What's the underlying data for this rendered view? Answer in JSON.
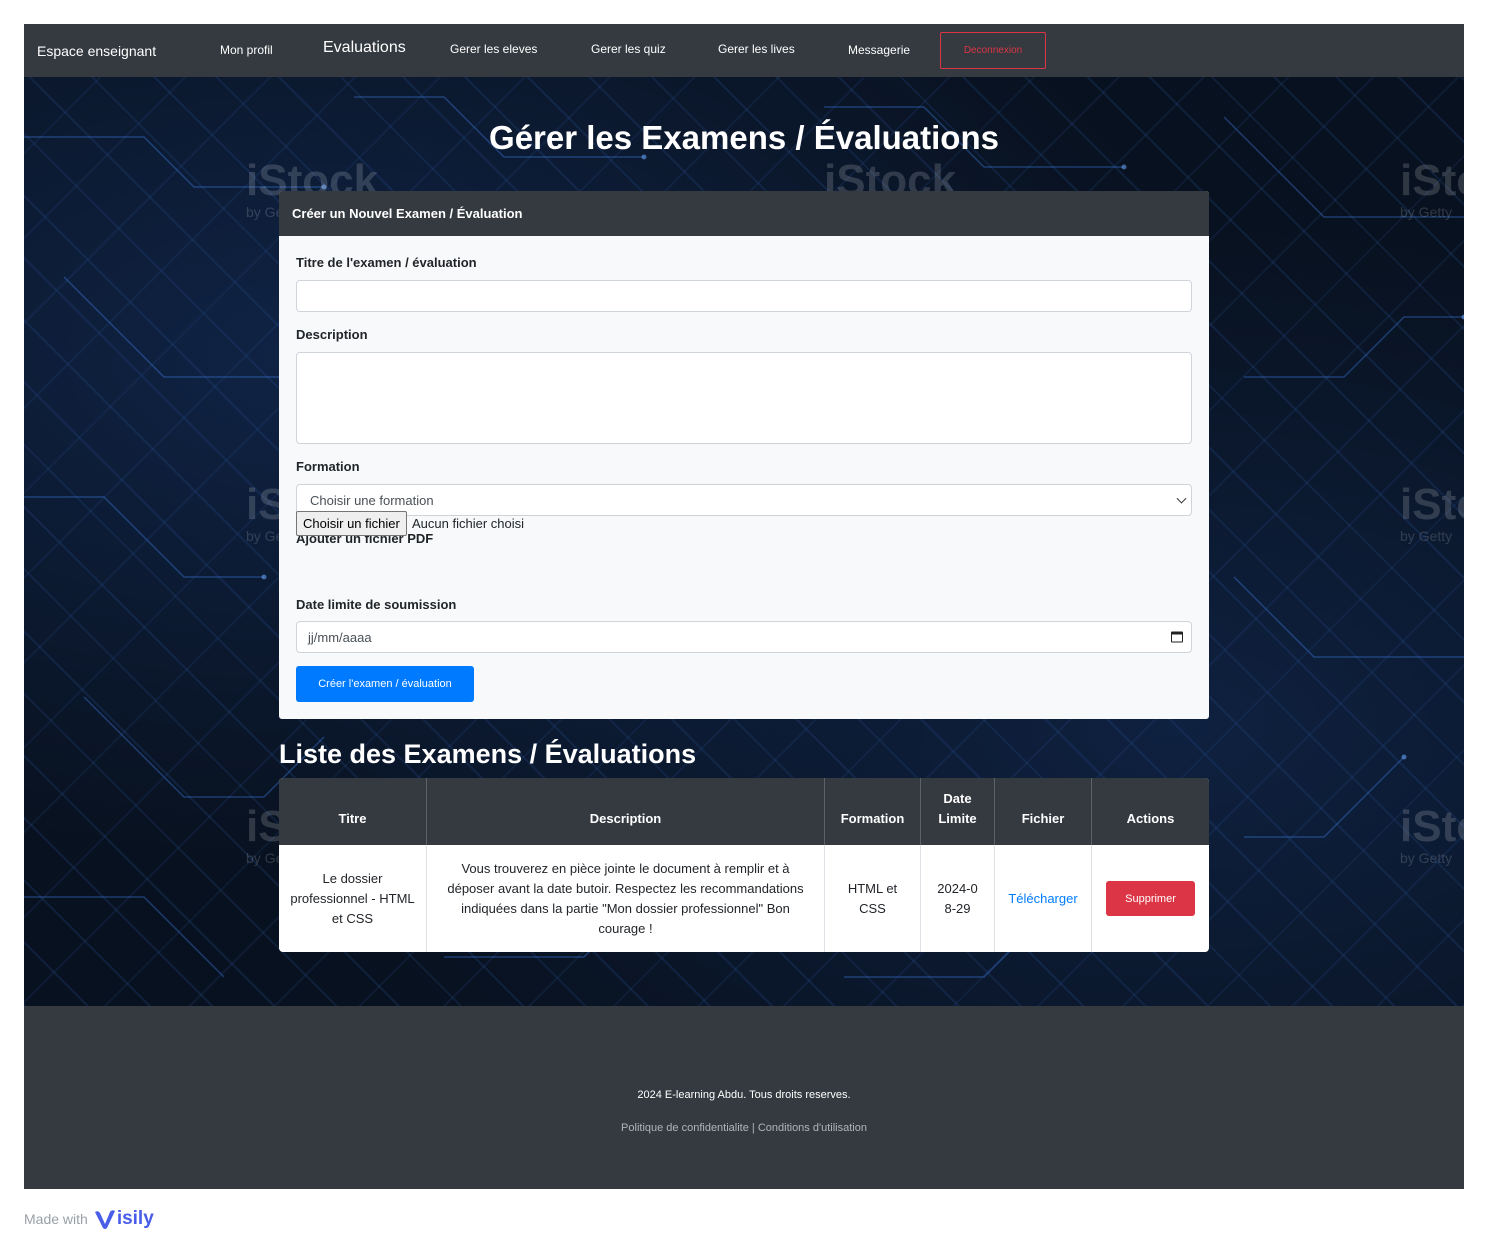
{
  "nav": {
    "brand": "Espace enseignant",
    "links": [
      "Mon profil",
      "Evaluations",
      "Gerer les eleves",
      "Gerer les quiz",
      "Gerer les lives",
      "Messagerie"
    ],
    "logout": "Deconnexion",
    "active_index": 1
  },
  "watermark": {
    "text": "iStock",
    "sub": "by Getty"
  },
  "page": {
    "title": "Gérer les Examens / Évaluations"
  },
  "form": {
    "header": "Créer un Nouvel Examen / Évaluation",
    "title_label": "Titre de l'examen / évaluation",
    "title_value": "",
    "description_label": "Description",
    "description_value": "",
    "formation_label": "Formation",
    "formation_selected": "Choisir une formation",
    "file_label": "Ajouter un fichier PDF",
    "file_button": "Choisir un fichier",
    "file_status": "Aucun fichier choisi",
    "date_label": "Date limite de soumission",
    "date_placeholder": "jj/mm/aaaa",
    "submit": "Créer l'examen / évaluation"
  },
  "list": {
    "title": "Liste des Examens / Évaluations",
    "headers": [
      "Titre",
      "Description",
      "Formation",
      "Date Limite",
      "Fichier",
      "Actions"
    ],
    "rows": [
      {
        "titre": "Le dossier professionnel - HTML et CSS",
        "description": "Vous trouverez en pièce jointe le document à remplir et à déposer avant la date butoir. Respectez les recommandations indiquées dans la partie \"Mon dossier professionnel\" Bon courage !",
        "formation": "HTML et CSS",
        "date": "2024-08-29",
        "fichier": "Télécharger",
        "action": "Supprimer"
      }
    ]
  },
  "footer": {
    "copyright": "2024 E-learning Abdu. Tous droits reserves.",
    "links": "Politique de confidentialite | Conditions d'utilisation"
  },
  "badge": {
    "made_with": "Made with",
    "brand": "isily"
  },
  "colors": {
    "navbar": "#343a40",
    "primary": "#007bff",
    "danger": "#dc3545",
    "card": "#f8f9fa",
    "hero_bg": "#08111f"
  }
}
